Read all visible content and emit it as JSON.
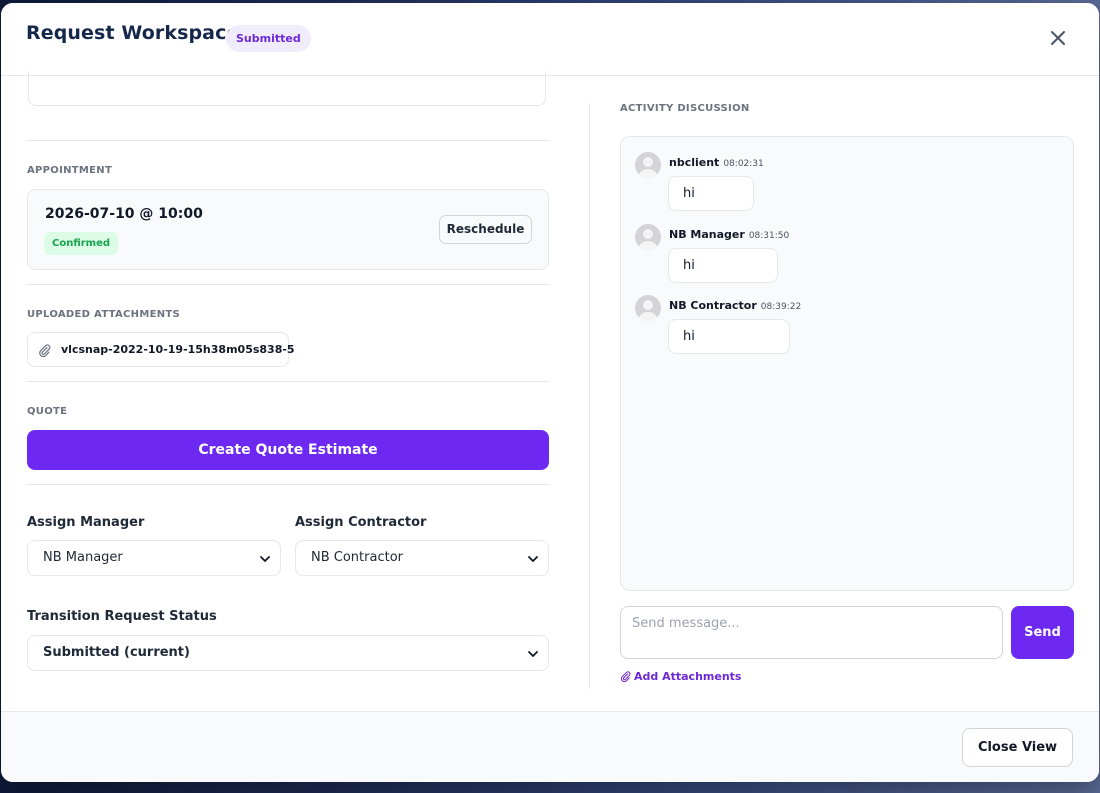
{
  "header": {
    "title": "Request Workspace",
    "status_badge": "Submitted"
  },
  "appointment": {
    "section_label": "APPOINTMENT",
    "datetime": "2026-07-10 @ 10:00",
    "status": "Confirmed",
    "reschedule_label": "Reschedule"
  },
  "attachments": {
    "section_label": "UPLOADED ATTACHMENTS",
    "files": [
      "vlcsnap-2022-10-19-15h38m05s838-5"
    ]
  },
  "quote": {
    "section_label": "QUOTE",
    "button_label": "Create Quote Estimate"
  },
  "assign_manager": {
    "label": "Assign Manager",
    "selected": "NB Manager"
  },
  "assign_contractor": {
    "label": "Assign Contractor",
    "selected": "NB Contractor"
  },
  "transition_status": {
    "label": "Transition Request Status",
    "selected": "Submitted (current)"
  },
  "discussion": {
    "section_label": "ACTIVITY DISCUSSION",
    "messages": [
      {
        "author": "nbclient",
        "time": "08:02:31",
        "text": "hi"
      },
      {
        "author": "NB Manager",
        "time": "08:31:50",
        "text": "hi"
      },
      {
        "author": "NB Contractor",
        "time": "08:39:22",
        "text": "hi"
      }
    ],
    "input_placeholder": "Send message...",
    "send_label": "Send",
    "add_attachments_label": "Add Attachments"
  },
  "footer": {
    "close_view_label": "Close View"
  },
  "colors": {
    "accent": "#6d28f2",
    "title": "#15284b",
    "confirmed_bg": "#dcfce7",
    "confirmed_text": "#16a34a",
    "submitted_bg": "#f1ecfb",
    "submitted_text": "#6d28d9"
  },
  "icons": {
    "close": "close-icon",
    "attachment": "paperclip-icon",
    "dropdown": "chevron-down-icon",
    "avatar": "user-avatar-icon"
  }
}
